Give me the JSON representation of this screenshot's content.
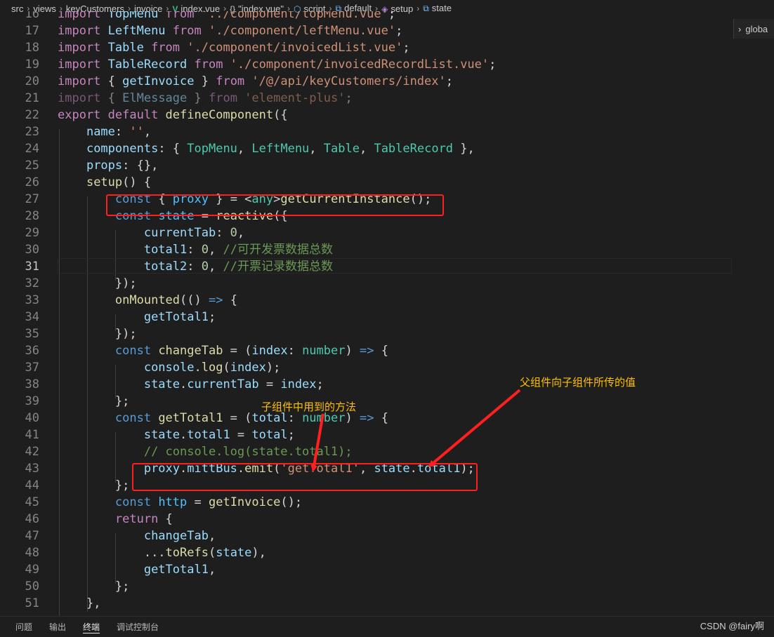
{
  "breadcrumb": {
    "items": [
      {
        "icon": "",
        "label": "src"
      },
      {
        "icon": "",
        "label": "views"
      },
      {
        "icon": "",
        "label": "keyCustomers"
      },
      {
        "icon": "",
        "label": "invoice"
      },
      {
        "icon": "vue-file-icon",
        "label": "index.vue"
      },
      {
        "icon": "object-braces-icon",
        "label": "\"index.vue\""
      },
      {
        "icon": "symbol-module-icon",
        "label": "script"
      },
      {
        "icon": "symbol-variable-icon",
        "label": "default"
      },
      {
        "icon": "symbol-method-icon",
        "label": "setup"
      },
      {
        "icon": "symbol-variable-icon",
        "label": "state"
      }
    ],
    "glyphs": {
      "vue-file-icon": "V",
      "object-braces-icon": "{}",
      "symbol-module-icon": "⬡",
      "symbol-variable-icon": "⧉",
      "symbol-method-icon": "◈"
    }
  },
  "sticky_scroll": {
    "label": "globa"
  },
  "editor": {
    "active_line": 31,
    "lines": [
      {
        "n": 16,
        "t": [
          [
            "import ",
            "kw"
          ],
          [
            "TopMenu ",
            "var"
          ],
          [
            "from ",
            "kw"
          ],
          [
            "'../component/topMenu.vue'",
            "str"
          ],
          [
            ";",
            "pun"
          ]
        ]
      },
      {
        "n": 17,
        "t": [
          [
            "import ",
            "kw"
          ],
          [
            "LeftMenu ",
            "var"
          ],
          [
            "from ",
            "kw"
          ],
          [
            "'./component/leftMenu.vue'",
            "str"
          ],
          [
            ";",
            "pun"
          ]
        ]
      },
      {
        "n": 18,
        "t": [
          [
            "import ",
            "kw"
          ],
          [
            "Table ",
            "var"
          ],
          [
            "from ",
            "kw"
          ],
          [
            "'./component/invoicedList.vue'",
            "str"
          ],
          [
            ";",
            "pun"
          ]
        ]
      },
      {
        "n": 19,
        "t": [
          [
            "import ",
            "kw"
          ],
          [
            "TableRecord ",
            "var"
          ],
          [
            "from ",
            "kw"
          ],
          [
            "'./component/invoicedRecordList.vue'",
            "str"
          ],
          [
            ";",
            "pun"
          ]
        ]
      },
      {
        "n": 20,
        "t": [
          [
            "import ",
            "kw"
          ],
          [
            "{ ",
            "pun"
          ],
          [
            "getInvoice ",
            "var"
          ],
          [
            "} ",
            "pun"
          ],
          [
            "from ",
            "kw"
          ],
          [
            "'/@/api/keyCustomers/index'",
            "str"
          ],
          [
            ";",
            "pun"
          ]
        ]
      },
      {
        "n": 21,
        "dim": true,
        "t": [
          [
            "import ",
            "kw"
          ],
          [
            "{ ",
            "pun"
          ],
          [
            "ElMessage ",
            "var"
          ],
          [
            "} ",
            "pun"
          ],
          [
            "from ",
            "kw"
          ],
          [
            "'element-plus'",
            "str"
          ],
          [
            ";",
            "pun"
          ]
        ]
      },
      {
        "n": 22,
        "t": [
          [
            "export ",
            "kw"
          ],
          [
            "default ",
            "kw"
          ],
          [
            "defineComponent",
            "fnc"
          ],
          [
            "({",
            "pun"
          ]
        ]
      },
      {
        "n": 23,
        "t": [
          [
            "    ",
            "pun"
          ],
          [
            "name",
            "var"
          ],
          [
            ": ",
            "pun"
          ],
          [
            "''",
            "str"
          ],
          [
            ",",
            "pun"
          ]
        ]
      },
      {
        "n": 24,
        "t": [
          [
            "    ",
            "pun"
          ],
          [
            "components",
            "var"
          ],
          [
            ": { ",
            "pun"
          ],
          [
            "TopMenu",
            "cls"
          ],
          [
            ", ",
            "pun"
          ],
          [
            "LeftMenu",
            "cls"
          ],
          [
            ", ",
            "pun"
          ],
          [
            "Table",
            "cls"
          ],
          [
            ", ",
            "pun"
          ],
          [
            "TableRecord",
            "cls"
          ],
          [
            " },",
            "pun"
          ]
        ]
      },
      {
        "n": 25,
        "t": [
          [
            "    ",
            "pun"
          ],
          [
            "props",
            "var"
          ],
          [
            ": {},",
            "pun"
          ]
        ]
      },
      {
        "n": 26,
        "t": [
          [
            "    ",
            "pun"
          ],
          [
            "setup",
            "fnc"
          ],
          [
            "() {",
            "pun"
          ]
        ]
      },
      {
        "n": 27,
        "t": [
          [
            "        ",
            "pun"
          ],
          [
            "const ",
            "kw2"
          ],
          [
            "{ ",
            "pun"
          ],
          [
            "proxy ",
            "cst"
          ],
          [
            "} = <",
            "pun"
          ],
          [
            "any",
            "cls"
          ],
          [
            ">",
            "pun"
          ],
          [
            "getCurrentInstance",
            "fnc"
          ],
          [
            "();",
            "pun"
          ]
        ]
      },
      {
        "n": 28,
        "t": [
          [
            "        ",
            "pun"
          ],
          [
            "const ",
            "kw2"
          ],
          [
            "state ",
            "cst"
          ],
          [
            "= ",
            "pun"
          ],
          [
            "reactive",
            "fnc"
          ],
          [
            "({",
            "pun"
          ]
        ]
      },
      {
        "n": 29,
        "t": [
          [
            "            ",
            "pun"
          ],
          [
            "currentTab",
            "var"
          ],
          [
            ": ",
            "pun"
          ],
          [
            "0",
            "num"
          ],
          [
            ",",
            "pun"
          ]
        ]
      },
      {
        "n": 30,
        "t": [
          [
            "            ",
            "pun"
          ],
          [
            "total1",
            "var"
          ],
          [
            ": ",
            "pun"
          ],
          [
            "0",
            "num"
          ],
          [
            ", ",
            "pun"
          ],
          [
            "//可开发票数据总数",
            "cmt"
          ]
        ]
      },
      {
        "n": 31,
        "t": [
          [
            "            ",
            "pun"
          ],
          [
            "total2",
            "var"
          ],
          [
            ": ",
            "pun"
          ],
          [
            "0",
            "num"
          ],
          [
            ", ",
            "pun"
          ],
          [
            "//开票记录数据总数",
            "cmt"
          ]
        ]
      },
      {
        "n": 32,
        "t": [
          [
            "        ",
            "pun"
          ],
          [
            "});",
            "pun"
          ]
        ]
      },
      {
        "n": 33,
        "t": [
          [
            "        ",
            "pun"
          ],
          [
            "onMounted",
            "fnc"
          ],
          [
            "(() ",
            "pun"
          ],
          [
            "=> ",
            "kw2"
          ],
          [
            "{",
            "pun"
          ]
        ]
      },
      {
        "n": 34,
        "t": [
          [
            "            ",
            "pun"
          ],
          [
            "getTotal1",
            "var"
          ],
          [
            ";",
            "pun"
          ]
        ]
      },
      {
        "n": 35,
        "t": [
          [
            "        ",
            "pun"
          ],
          [
            "});",
            "pun"
          ]
        ]
      },
      {
        "n": 36,
        "t": [
          [
            "        ",
            "pun"
          ],
          [
            "const ",
            "kw2"
          ],
          [
            "changeTab ",
            "fnc"
          ],
          [
            "= (",
            "pun"
          ],
          [
            "index",
            "var"
          ],
          [
            ": ",
            "pun"
          ],
          [
            "number",
            "cls"
          ],
          [
            ") ",
            "pun"
          ],
          [
            "=> ",
            "kw2"
          ],
          [
            "{",
            "pun"
          ]
        ]
      },
      {
        "n": 37,
        "t": [
          [
            "            ",
            "pun"
          ],
          [
            "console",
            "var"
          ],
          [
            ".",
            "pun"
          ],
          [
            "log",
            "fnc"
          ],
          [
            "(",
            "pun"
          ],
          [
            "index",
            "var"
          ],
          [
            ");",
            "pun"
          ]
        ]
      },
      {
        "n": 38,
        "t": [
          [
            "            ",
            "pun"
          ],
          [
            "state",
            "var"
          ],
          [
            ".",
            "pun"
          ],
          [
            "currentTab ",
            "var"
          ],
          [
            "= ",
            "pun"
          ],
          [
            "index",
            "var"
          ],
          [
            ";",
            "pun"
          ]
        ]
      },
      {
        "n": 39,
        "t": [
          [
            "        ",
            "pun"
          ],
          [
            "};",
            "pun"
          ]
        ]
      },
      {
        "n": 40,
        "t": [
          [
            "        ",
            "pun"
          ],
          [
            "const ",
            "kw2"
          ],
          [
            "getTotal1 ",
            "fnc"
          ],
          [
            "= (",
            "pun"
          ],
          [
            "total",
            "var"
          ],
          [
            ": ",
            "pun"
          ],
          [
            "number",
            "cls"
          ],
          [
            ") ",
            "pun"
          ],
          [
            "=> ",
            "kw2"
          ],
          [
            "{",
            "pun"
          ]
        ]
      },
      {
        "n": 41,
        "t": [
          [
            "            ",
            "pun"
          ],
          [
            "state",
            "var"
          ],
          [
            ".",
            "pun"
          ],
          [
            "total1 ",
            "var"
          ],
          [
            "= ",
            "pun"
          ],
          [
            "total",
            "var"
          ],
          [
            ";",
            "pun"
          ]
        ]
      },
      {
        "n": 42,
        "t": [
          [
            "            ",
            "pun"
          ],
          [
            "// console.log(state.total1);",
            "cmt"
          ]
        ]
      },
      {
        "n": 43,
        "t": [
          [
            "            ",
            "pun"
          ],
          [
            "proxy",
            "var"
          ],
          [
            ".",
            "pun"
          ],
          [
            "mittBus",
            "var"
          ],
          [
            ".",
            "pun"
          ],
          [
            "emit",
            "fnc"
          ],
          [
            "(",
            "pun"
          ],
          [
            "'getTotal1'",
            "str"
          ],
          [
            ", ",
            "pun"
          ],
          [
            "state",
            "var"
          ],
          [
            ".",
            "pun"
          ],
          [
            "total1",
            "var"
          ],
          [
            ");",
            "pun"
          ]
        ]
      },
      {
        "n": 44,
        "t": [
          [
            "        ",
            "pun"
          ],
          [
            "};",
            "pun"
          ]
        ]
      },
      {
        "n": 45,
        "t": [
          [
            "        ",
            "pun"
          ],
          [
            "const ",
            "kw2"
          ],
          [
            "http ",
            "cst"
          ],
          [
            "= ",
            "pun"
          ],
          [
            "getInvoice",
            "fnc"
          ],
          [
            "();",
            "pun"
          ]
        ]
      },
      {
        "n": 46,
        "t": [
          [
            "        ",
            "pun"
          ],
          [
            "return ",
            "kw"
          ],
          [
            "{",
            "pun"
          ]
        ]
      },
      {
        "n": 47,
        "t": [
          [
            "            ",
            "pun"
          ],
          [
            "changeTab",
            "var"
          ],
          [
            ",",
            "pun"
          ]
        ]
      },
      {
        "n": 48,
        "t": [
          [
            "            ",
            "pun"
          ],
          [
            "...",
            "pun"
          ],
          [
            "toRefs",
            "fnc"
          ],
          [
            "(",
            "pun"
          ],
          [
            "state",
            "var"
          ],
          [
            "),",
            "pun"
          ]
        ]
      },
      {
        "n": 49,
        "t": [
          [
            "            ",
            "pun"
          ],
          [
            "getTotal1",
            "var"
          ],
          [
            ",",
            "pun"
          ]
        ]
      },
      {
        "n": 50,
        "t": [
          [
            "        ",
            "pun"
          ],
          [
            "};",
            "pun"
          ]
        ]
      },
      {
        "n": 51,
        "t": [
          [
            "    ",
            "pun"
          ],
          [
            "},",
            "pun"
          ]
        ]
      }
    ]
  },
  "annotations": {
    "parent_to_child": "父组件向子组件所传的值",
    "child_method": "子组件中用到的方法",
    "color": "#ffc000",
    "box_color": "#ff1f1f"
  },
  "panel": {
    "tabs": [
      "问题",
      "输出",
      "终端",
      "调试控制台"
    ],
    "active_tab": "终端"
  },
  "watermark": "CSDN @fairy啊"
}
